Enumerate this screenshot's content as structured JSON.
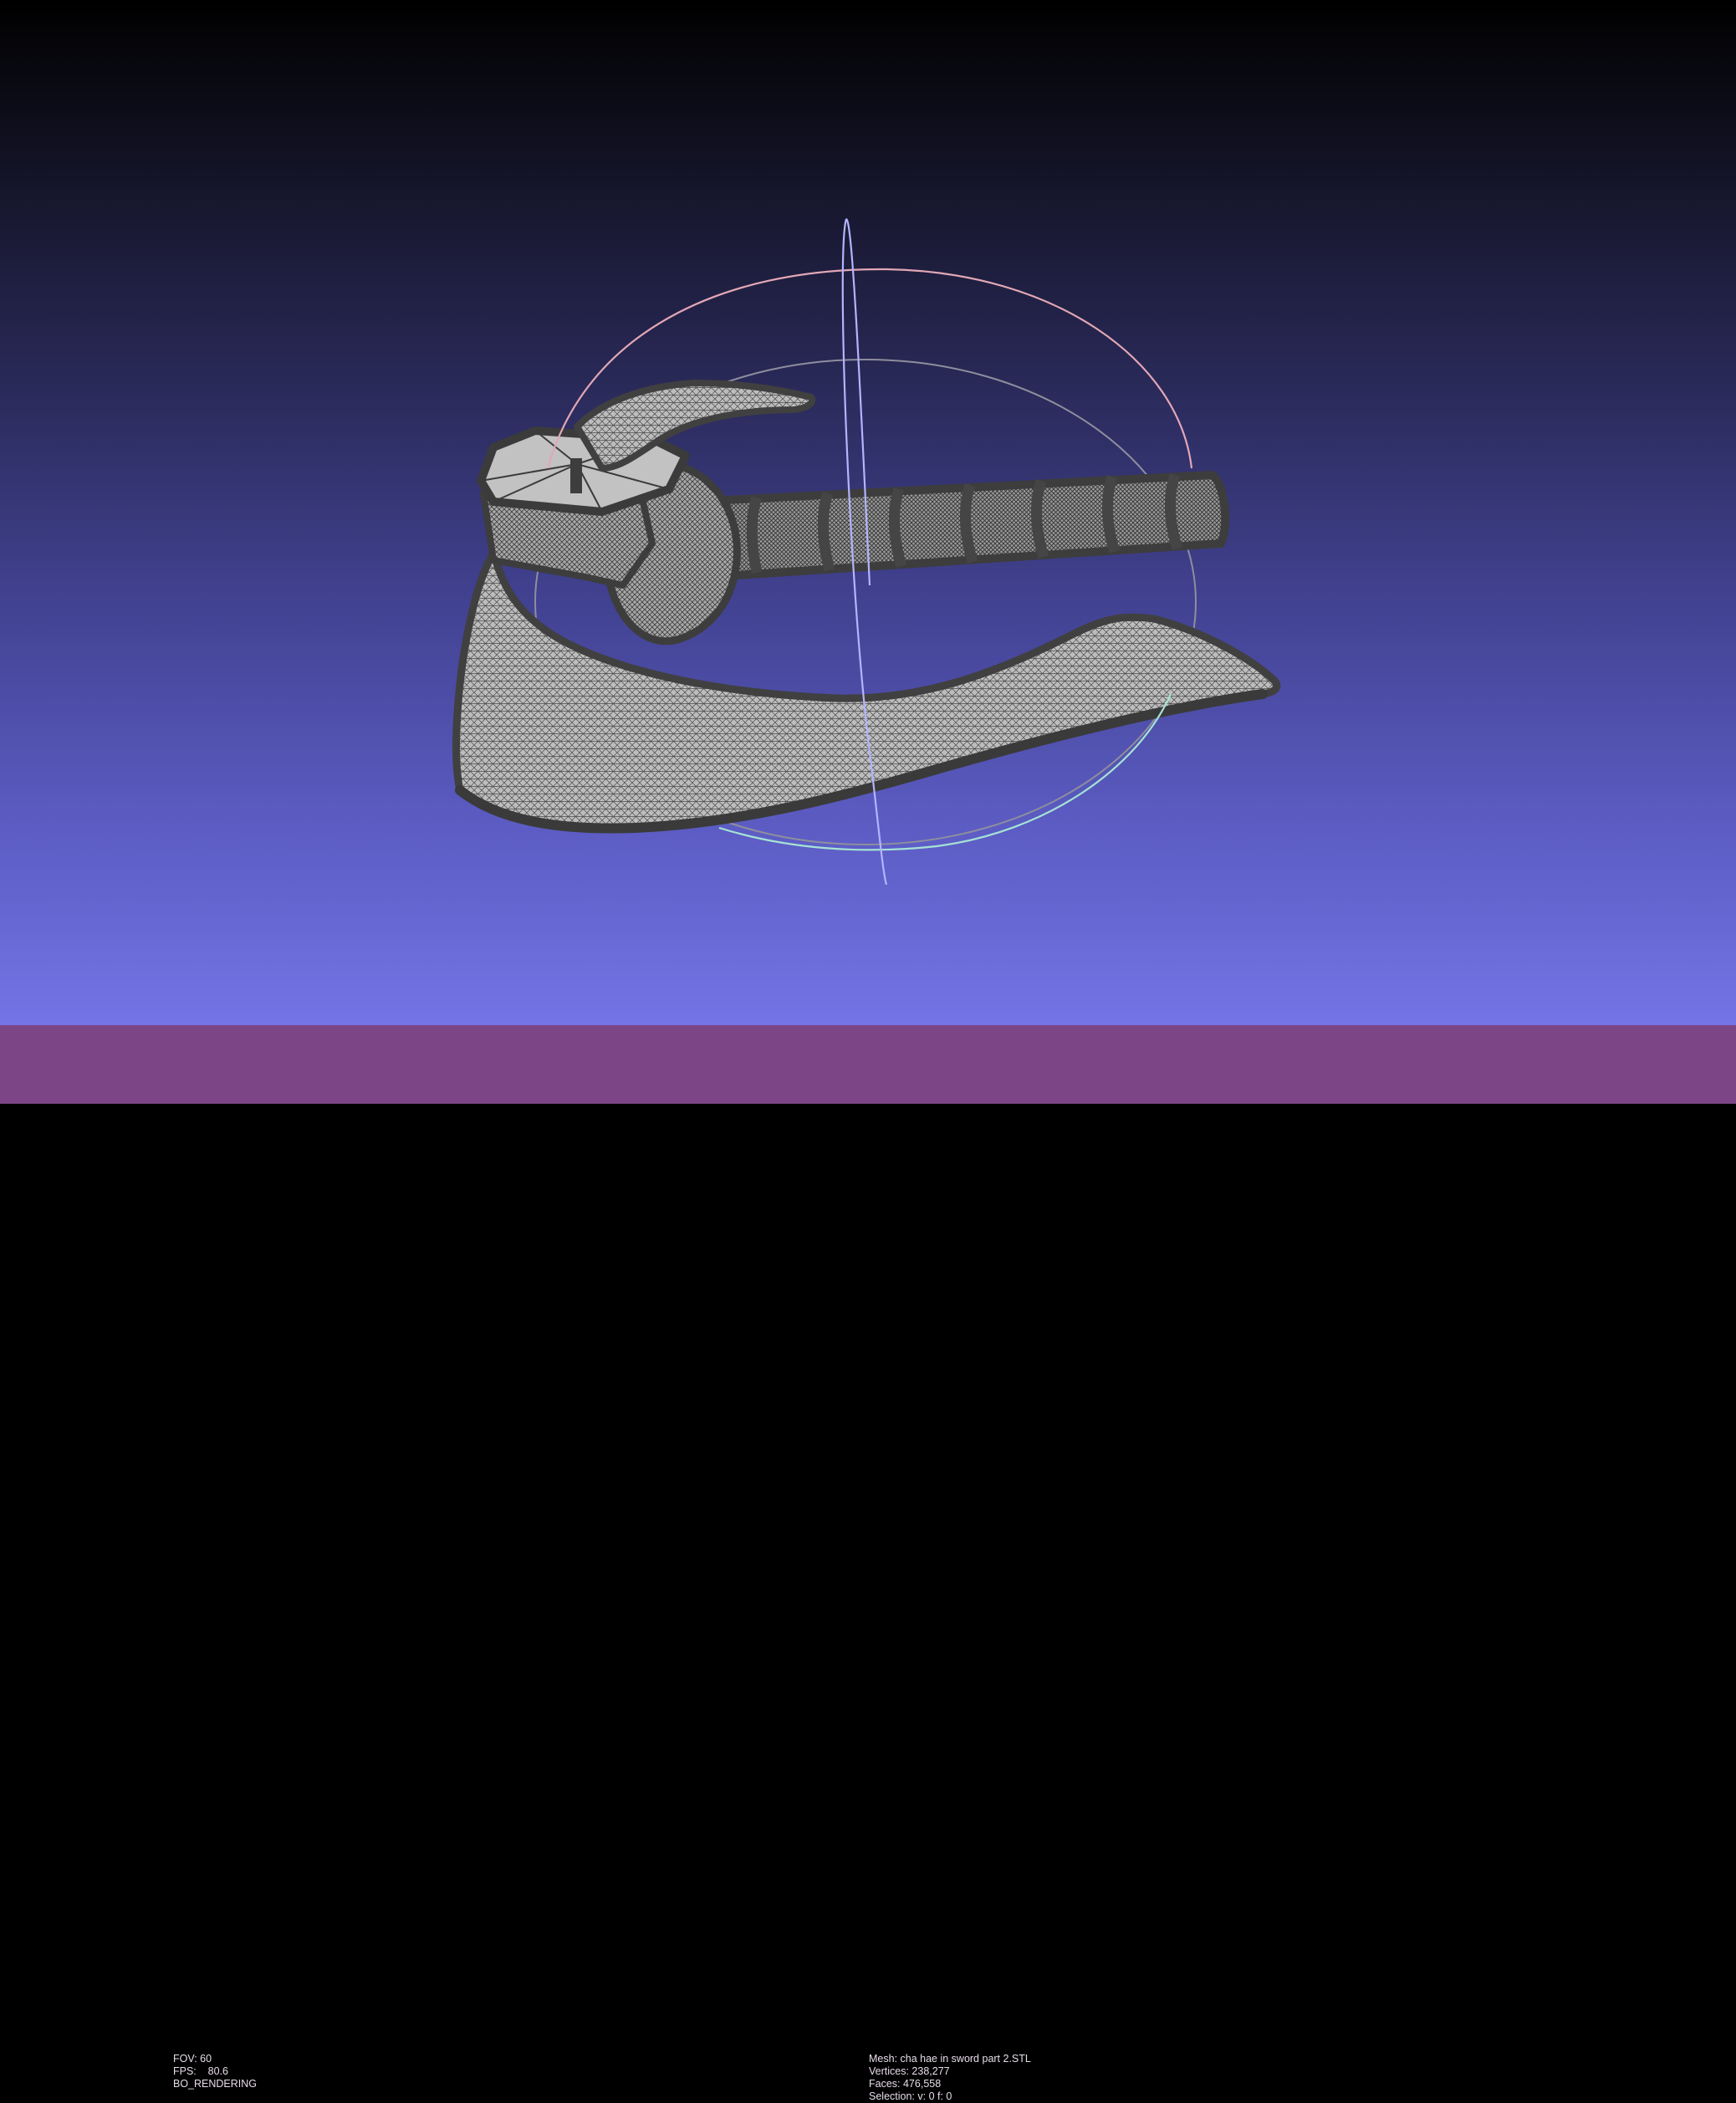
{
  "viewport": {
    "background_top": "#000000",
    "background_bottom": "#7474e6",
    "mesh_color": "#b4b4b4",
    "edge_color": "#3c3c3c",
    "trackball_colors": {
      "x_ring": "#e0a0b0",
      "y_ring": "#b0b0ff",
      "z_ring": "#a0e0d0",
      "inner_ring": "#909090"
    }
  },
  "status_left": {
    "fov": "FOV: 60",
    "fps": "FPS:    80.6",
    "render_mode": "BO_RENDERING"
  },
  "status_right": {
    "mesh": "Mesh: cha hae in sword part 2.STL",
    "vertices": "Vertices: 238,277",
    "faces": "Faces: 476,558",
    "selection": "Selection: v: 0 f: 0"
  },
  "statusbar_color": "#7c4585"
}
